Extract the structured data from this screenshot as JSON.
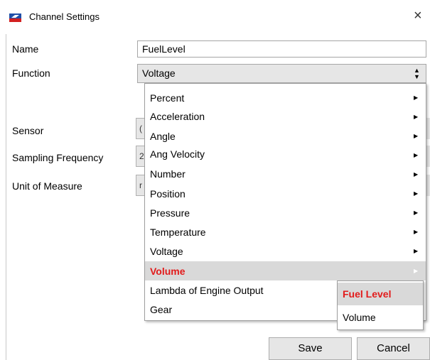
{
  "window": {
    "title": "Channel Settings",
    "close_glyph": "×",
    "icon": "app-logo-icon"
  },
  "form": {
    "name_label": "Name",
    "name_value": "FuelLevel",
    "function_label": "Function",
    "function_value": "Voltage",
    "sensor_label": "Sensor",
    "sampling_label": "Sampling Frequency",
    "sampling_partial": "2",
    "unit_label": "Unit of Measure",
    "unit_partial": "r",
    "sensor_partial": "("
  },
  "menu": {
    "items": [
      {
        "label": "Percent",
        "has_submenu": true
      },
      {
        "label": "Acceleration",
        "has_submenu": true
      },
      {
        "label": "Angle",
        "has_submenu": true
      },
      {
        "label": "Ang Velocity",
        "has_submenu": true
      },
      {
        "label": "Number",
        "has_submenu": true
      },
      {
        "label": "Position",
        "has_submenu": true
      },
      {
        "label": "Pressure",
        "has_submenu": true
      },
      {
        "label": "Temperature",
        "has_submenu": true
      },
      {
        "label": "Voltage",
        "has_submenu": true
      },
      {
        "label": "Volume",
        "has_submenu": true,
        "active": true
      },
      {
        "label": "Lambda of Engine Output",
        "has_submenu": false
      },
      {
        "label": "Gear",
        "has_submenu": false
      }
    ],
    "arrow_glyph": "▶"
  },
  "submenu": {
    "items": [
      {
        "label": "Fuel Level",
        "active": true
      },
      {
        "label": "Volume",
        "active": false
      }
    ]
  },
  "buttons": {
    "save": "Save",
    "cancel": "Cancel"
  },
  "colors": {
    "highlight_text": "#e21b1b",
    "highlight_bg": "#d9d9d9"
  }
}
